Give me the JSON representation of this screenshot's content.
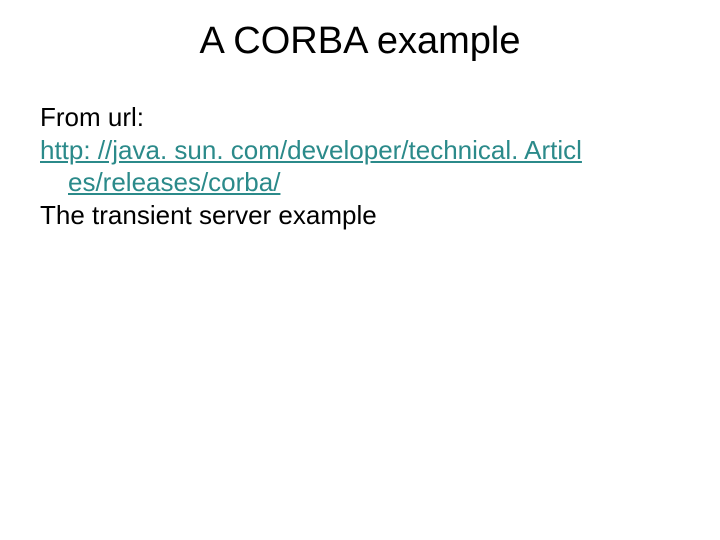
{
  "title": "A CORBA example",
  "body": {
    "from_label": "From url:",
    "link_line1": "http: //java. sun. com/developer/technical. Articl",
    "link_line2": "es/releases/corba/",
    "after": "The transient server example"
  }
}
